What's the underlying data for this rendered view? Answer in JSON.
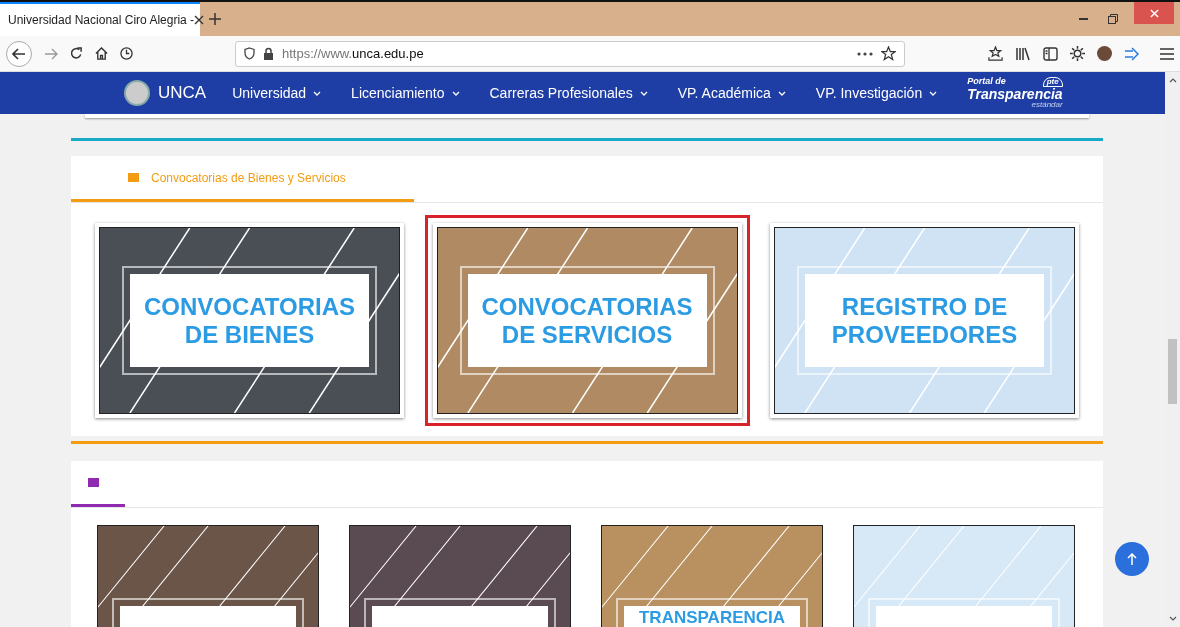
{
  "browser": {
    "tab": {
      "title": "Universidad Nacional Ciro Alegria -",
      "selected": true
    },
    "url": {
      "prefix": "https://www.",
      "domain": "unca.edu.pe"
    }
  },
  "navbar": {
    "brand": "UNCA",
    "items": [
      {
        "label": "Universidad"
      },
      {
        "label": "Licenciamiento"
      },
      {
        "label": "Carreras Profesionales"
      },
      {
        "label": "VP. Académica"
      },
      {
        "label": "VP. Investigación"
      }
    ],
    "portal": {
      "top": "Portal de",
      "main": "Transparencia",
      "sub": "estándar",
      "badge": "pte"
    }
  },
  "section1": {
    "title": "Convocatorias de Bienes y Servicios",
    "cards": [
      {
        "label": "CONVOCATORIAS DE BIENES",
        "highlighted": false
      },
      {
        "label": "CONVOCATORIAS DE SERVICIOS",
        "highlighted": true
      },
      {
        "label": "REGISTRO DE PROVEEDORES",
        "highlighted": false
      }
    ]
  },
  "section2": {
    "cards": [
      {
        "kind": "image"
      },
      {
        "kind": "image"
      },
      {
        "kind": "image",
        "label": "TRANSPARENCIA"
      },
      {
        "kind": "image"
      }
    ]
  }
}
